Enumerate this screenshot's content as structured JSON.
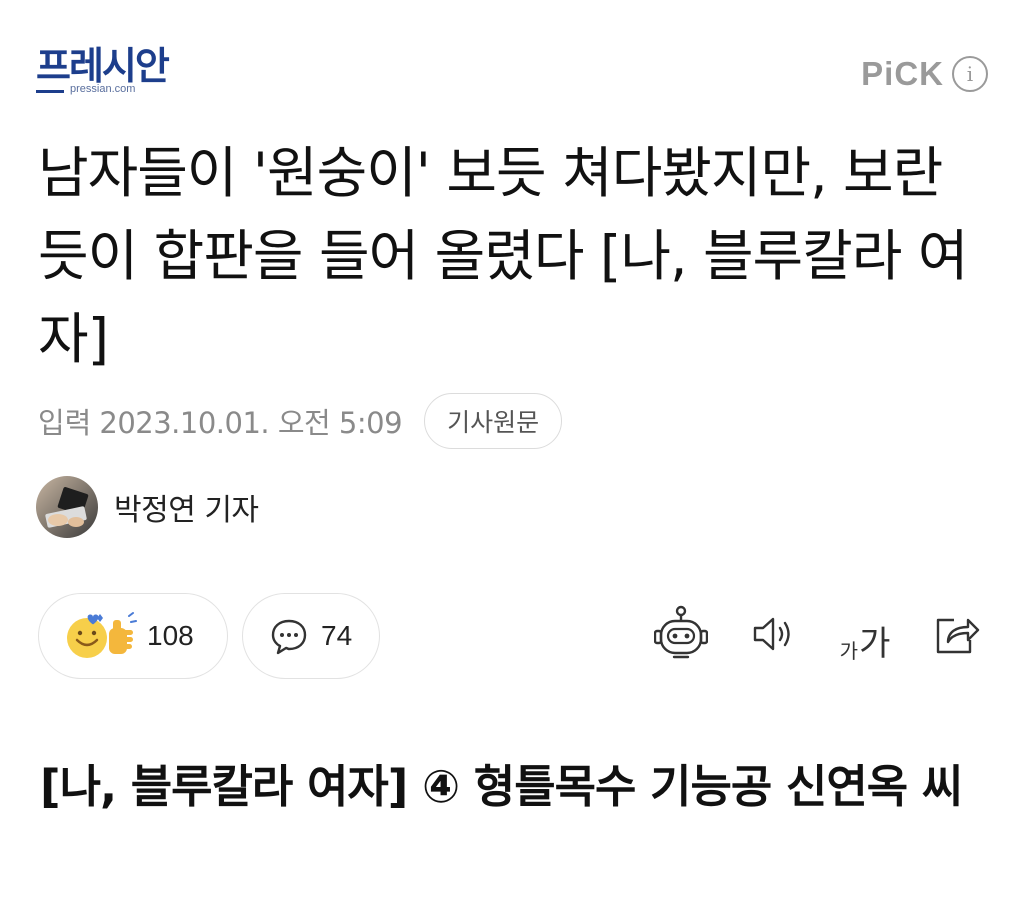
{
  "header": {
    "logo_text": "프레시안",
    "logo_subtext": "pressian.com",
    "pick_label": "PiCK",
    "info_icon": "info-icon"
  },
  "article": {
    "title": "남자들이 '원숭이' 보듯 쳐다봤지만, 보란듯이 합판을 들어 올렸다 [나, 블루칼라 여자]",
    "published_label": "입력",
    "published_datetime": "2023.10.01. 오전 5:09",
    "original_button_label": "기사원문",
    "author_name": "박정연 기자",
    "subtitle": "[나, 블루칼라 여자] ④ 형틀목수 기능공 신연옥 씨"
  },
  "reactions": {
    "like_count": "108",
    "comment_count": "74"
  },
  "toolbar": {
    "font_small": "가",
    "font_big": "가",
    "icons": [
      "robot-summary-icon",
      "speaker-icon",
      "font-size-icon",
      "share-icon"
    ]
  },
  "colors": {
    "brand": "#1d3e8c",
    "meta_gray": "#8a8a8a",
    "border": "#e2e2e2"
  }
}
